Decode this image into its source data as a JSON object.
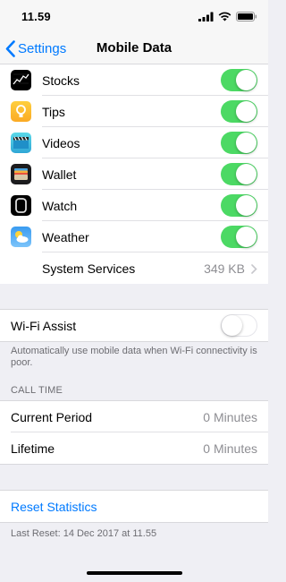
{
  "status": {
    "time": "11.59"
  },
  "nav": {
    "back_label": "Settings",
    "title": "Mobile Data"
  },
  "apps": [
    {
      "label": "Stocks",
      "icon": "stocks-icon",
      "enabled": true
    },
    {
      "label": "Tips",
      "icon": "tips-icon",
      "enabled": true
    },
    {
      "label": "Videos",
      "icon": "videos-icon",
      "enabled": true
    },
    {
      "label": "Wallet",
      "icon": "wallet-icon",
      "enabled": true
    },
    {
      "label": "Watch",
      "icon": "watch-icon",
      "enabled": true
    },
    {
      "label": "Weather",
      "icon": "weather-icon",
      "enabled": true
    }
  ],
  "system_services": {
    "label": "System Services",
    "value": "349 KB"
  },
  "wifi_assist": {
    "label": "Wi-Fi Assist",
    "enabled": false,
    "footer": "Automatically use mobile data when Wi-Fi connectivity is poor."
  },
  "call_time": {
    "header": "CALL TIME",
    "current_period": {
      "label": "Current Period",
      "value": "0 Minutes"
    },
    "lifetime": {
      "label": "Lifetime",
      "value": "0 Minutes"
    }
  },
  "reset": {
    "label": "Reset Statistics",
    "last_reset": "Last Reset: 14 Dec 2017 at 11.55"
  },
  "colors": {
    "accent": "#007aff",
    "toggle_on": "#4cd964",
    "background": "#efeff4"
  }
}
